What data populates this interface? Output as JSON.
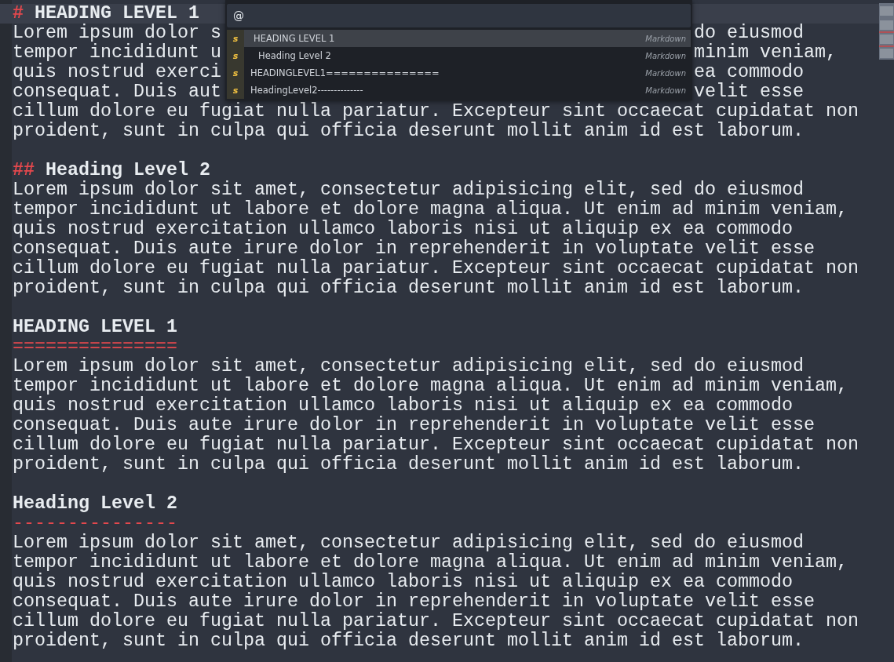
{
  "editor": {
    "lines": [
      {
        "kind": "heading",
        "marker": "#",
        "text": "HEADING LEVEL 1",
        "current": true
      },
      {
        "kind": "split",
        "left": "Lorem ipsum dolor s",
        "right": "do eiusmod"
      },
      {
        "kind": "split",
        "left": "tempor incididunt u",
        "right": "minim veniam,"
      },
      {
        "kind": "split",
        "left": "quis nostrud exerci",
        "right": "ea commodo"
      },
      {
        "kind": "split",
        "left": "consequat. Duis aut",
        "right": "velit esse"
      },
      {
        "kind": "text",
        "text": "cillum dolore eu fugiat nulla pariatur. Excepteur sint occaecat cupidatat non"
      },
      {
        "kind": "text",
        "text": "proident, sunt in culpa qui officia deserunt mollit anim id est laborum."
      },
      {
        "kind": "blank"
      },
      {
        "kind": "heading",
        "marker": "##",
        "text": "Heading Level 2",
        "current": false
      },
      {
        "kind": "text",
        "text": "Lorem ipsum dolor sit amet, consectetur adipisicing elit, sed do eiusmod"
      },
      {
        "kind": "text",
        "text": "tempor incididunt ut labore et dolore magna aliqua. Ut enim ad minim veniam,"
      },
      {
        "kind": "text",
        "text": "quis nostrud exercitation ullamco laboris nisi ut aliquip ex ea commodo"
      },
      {
        "kind": "text",
        "text": "consequat. Duis aute irure dolor in reprehenderit in voluptate velit esse"
      },
      {
        "kind": "text",
        "text": "cillum dolore eu fugiat nulla pariatur. Excepteur sint occaecat cupidatat non"
      },
      {
        "kind": "text",
        "text": "proident, sunt in culpa qui officia deserunt mollit anim id est laborum."
      },
      {
        "kind": "blank"
      },
      {
        "kind": "setext",
        "text": "HEADING LEVEL 1"
      },
      {
        "kind": "underline",
        "text": "==============="
      },
      {
        "kind": "text",
        "text": "Lorem ipsum dolor sit amet, consectetur adipisicing elit, sed do eiusmod"
      },
      {
        "kind": "text",
        "text": "tempor incididunt ut labore et dolore magna aliqua. Ut enim ad minim veniam,"
      },
      {
        "kind": "text",
        "text": "quis nostrud exercitation ullamco laboris nisi ut aliquip ex ea commodo"
      },
      {
        "kind": "text",
        "text": "consequat. Duis aute irure dolor in reprehenderit in voluptate velit esse"
      },
      {
        "kind": "text",
        "text": "cillum dolore eu fugiat nulla pariatur. Excepteur sint occaecat cupidatat non"
      },
      {
        "kind": "text",
        "text": "proident, sunt in culpa qui officia deserunt mollit anim id est laborum."
      },
      {
        "kind": "blank"
      },
      {
        "kind": "setext",
        "text": "Heading Level 2"
      },
      {
        "kind": "underline",
        "text": "---------------"
      },
      {
        "kind": "text",
        "text": "Lorem ipsum dolor sit amet, consectetur adipisicing elit, sed do eiusmod"
      },
      {
        "kind": "text",
        "text": "tempor incididunt ut labore et dolore magna aliqua. Ut enim ad minim veniam,"
      },
      {
        "kind": "text",
        "text": "quis nostrud exercitation ullamco laboris nisi ut aliquip ex ea commodo"
      },
      {
        "kind": "text",
        "text": "consequat. Duis aute irure dolor in reprehenderit in voluptate velit esse"
      },
      {
        "kind": "text",
        "text": "cillum dolore eu fugiat nulla pariatur. Excepteur sint occaecat cupidatat non"
      },
      {
        "kind": "text",
        "text": "proident, sunt in culpa qui officia deserunt mollit anim id est laborum."
      }
    ]
  },
  "symbol_panel": {
    "query": "@",
    "items": [
      {
        "icon": "s",
        "label": "HEADING LEVEL 1",
        "syntax": "Markdown",
        "selected": true,
        "children": [
          {
            "icon": "s",
            "label": "Heading Level 2",
            "syntax": "Markdown",
            "selected": false
          }
        ]
      },
      {
        "icon": "s",
        "label": "HEADINGLEVEL1===============",
        "syntax": "Markdown",
        "selected": false
      },
      {
        "icon": "s",
        "label": "HeadingLevel2--------------",
        "syntax": "Markdown",
        "selected": false
      }
    ]
  }
}
